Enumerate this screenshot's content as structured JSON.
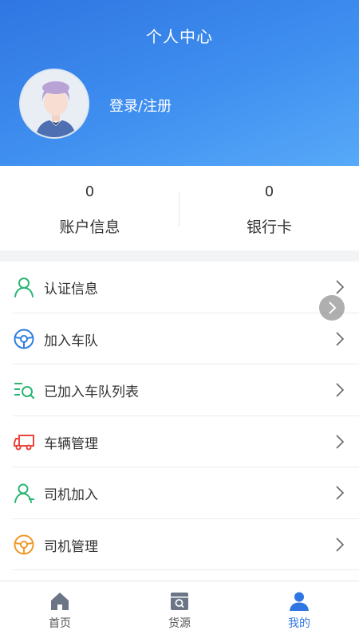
{
  "header": {
    "title": "个人中心",
    "login_label": "登录/注册"
  },
  "stats": [
    {
      "value": "0",
      "label": "账户信息"
    },
    {
      "value": "0",
      "label": "银行卡"
    }
  ],
  "menu": {
    "items": [
      {
        "label": "认证信息",
        "icon": "person-verify-icon",
        "color": "#2bb673"
      },
      {
        "label": "加入车队",
        "icon": "steering-wheel-icon",
        "color": "#2f7fe0"
      },
      {
        "label": "已加入车队列表",
        "icon": "list-search-icon",
        "color": "#2bb673"
      },
      {
        "label": "车辆管理",
        "icon": "truck-icon",
        "color": "#e8453c"
      },
      {
        "label": "司机加入",
        "icon": "person-add-icon",
        "color": "#2bb673"
      },
      {
        "label": "司机管理",
        "icon": "steering-wheel-icon",
        "color": "#f09a2c"
      }
    ]
  },
  "tabbar": {
    "tabs": [
      {
        "label": "首页",
        "icon": "home-icon",
        "active": false
      },
      {
        "label": "货源",
        "icon": "cargo-icon",
        "active": false
      },
      {
        "label": "我的",
        "icon": "profile-icon",
        "active": true
      }
    ],
    "active_color": "#2f76e2",
    "inactive_color": "#555555"
  },
  "colors": {
    "header_start": "#2f76e2",
    "header_end": "#57a9f8"
  }
}
